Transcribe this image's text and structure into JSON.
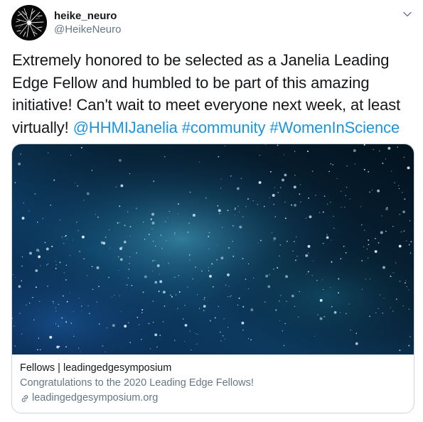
{
  "author": {
    "display_name": "heike_neuro",
    "handle": "@HeikeNeuro",
    "avatar_icon": "neuron-avatar"
  },
  "menu": {
    "icon": "chevron-down-icon"
  },
  "tweet": {
    "text_before": "Extremely honored to be selected as a Janelia Leading Edge Fellow and humbled to be part of this amazing initiative! Can't wait to meet everyone next week, at least virtually!",
    "mention": "@HHMIJanelia",
    "hashtag_1": "#community",
    "hashtag_2": "#WomenInScience",
    "link_color": "#1b95e0"
  },
  "card": {
    "image_icon": "galaxy-stars-image",
    "title": "Fellows | leadingedgesymposium",
    "description": "Congratulations to the 2020 Leading Edge Fellows!",
    "url": "leadingedgesymposium.org",
    "url_icon": "link-icon"
  }
}
